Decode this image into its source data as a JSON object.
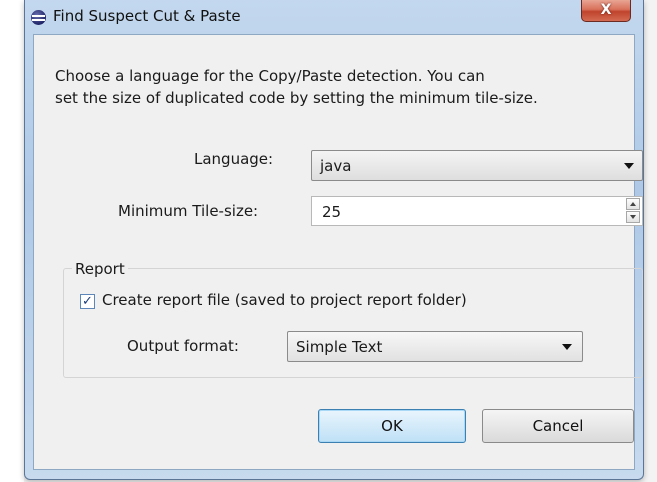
{
  "window": {
    "title": "Find Suspect Cut & Paste",
    "close_label": "X"
  },
  "description": {
    "line1": "Choose a language for the Copy/Paste detection. You can",
    "line2": "set the size of duplicated code by setting the minimum tile-size."
  },
  "language": {
    "label": "Language:",
    "value": "java"
  },
  "tile_size": {
    "label": "Minimum Tile-size:",
    "value": "25"
  },
  "report": {
    "group_label": "Report",
    "create_report_label": "Create report file (saved to project report folder)",
    "create_report_checked": true,
    "output_format_label": "Output format:",
    "output_format_value": "Simple Text"
  },
  "buttons": {
    "ok": "OK",
    "cancel": "Cancel"
  },
  "colors": {
    "titlebar": "#c3d8ee",
    "close_button": "#c0432c",
    "default_button_border": "#3c7fb1"
  }
}
